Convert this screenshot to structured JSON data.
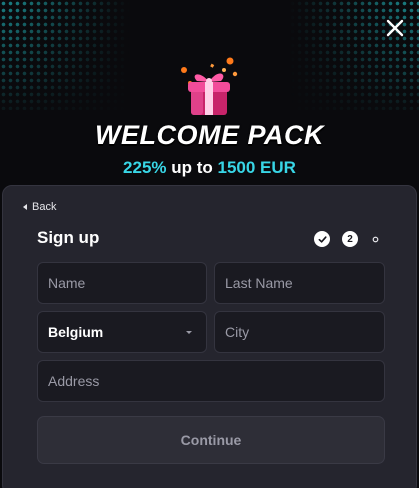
{
  "banner": {
    "headline": "WELCOME PACK",
    "offer_percent": "225%",
    "offer_mid": " up to ",
    "offer_amount": "1500 EUR",
    "accent_color": "#38d6e6"
  },
  "icons": {
    "close": "close-icon",
    "gift": "gift-icon",
    "back": "back-arrow-icon",
    "check": "check-icon",
    "dropdown": "chevron-down-icon"
  },
  "form": {
    "back_label": "Back",
    "title": "Sign up",
    "steps": [
      {
        "label": "✔",
        "state": "done"
      },
      {
        "label": "2",
        "state": "current"
      },
      {
        "label": "○",
        "state": "todo"
      }
    ],
    "name_placeholder": "Name",
    "last_name_placeholder": "Last Name",
    "country_value": "Belgium",
    "city_placeholder": "City",
    "address_placeholder": "Address",
    "continue_label": "Continue"
  }
}
